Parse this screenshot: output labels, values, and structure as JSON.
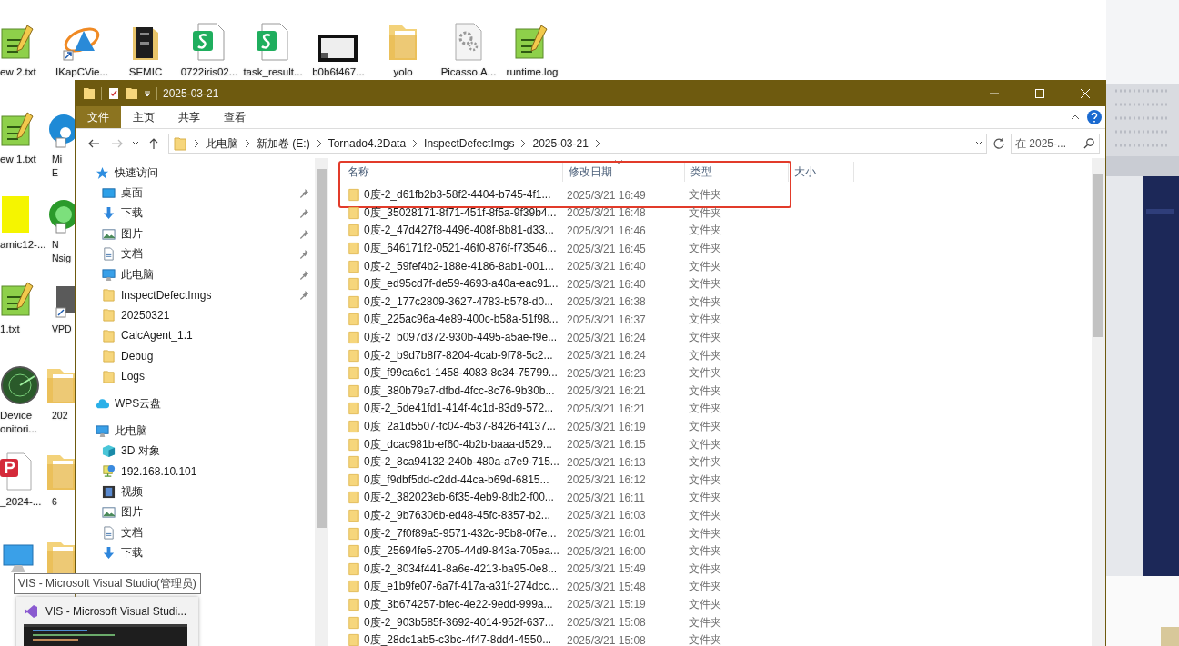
{
  "desktop": {
    "top_row": [
      {
        "kind": "notepad",
        "label": "ew 2.txt"
      },
      {
        "kind": "triangle-app",
        "label": "IKapCVie..."
      },
      {
        "kind": "dark-folder",
        "label": "SEMIC"
      },
      {
        "kind": "sheet",
        "label": "0722iris02..."
      },
      {
        "kind": "sheet",
        "label": "task_result..."
      },
      {
        "kind": "thumbnail",
        "label": "b0b6f467..."
      },
      {
        "kind": "folder",
        "label": "yolo"
      },
      {
        "kind": "gear-doc",
        "label": "Picasso.A..."
      },
      {
        "kind": "notepad",
        "label": "runtime.log"
      }
    ],
    "column_1": [
      {
        "kind": "notepad",
        "label": "ew 1.txt"
      },
      {
        "kind": "yellow-doc",
        "label": "amic12-..."
      },
      {
        "kind": "notepad",
        "label": "1.txt"
      },
      {
        "kind": "radar",
        "label": "Device\nonitori..."
      },
      {
        "kind": "pdf",
        "label": "_2024-..."
      },
      {
        "kind": "computer"
      }
    ],
    "column_2": [
      {
        "kind": "browser",
        "label": "Mi\nE"
      },
      {
        "kind": "green-orb",
        "label": "N\nNsig"
      },
      {
        "kind": "shortcut",
        "label": "VPD"
      },
      {
        "kind": "folder",
        "label": "202"
      },
      {
        "kind": "folder",
        "label": "6"
      },
      {
        "kind": "folder"
      }
    ]
  },
  "window": {
    "title": "2025-03-21",
    "tabs": [
      {
        "label": "文件",
        "selected": true
      },
      {
        "label": "主页",
        "selected": false
      },
      {
        "label": "共享",
        "selected": false
      },
      {
        "label": "查看",
        "selected": false
      }
    ],
    "address": {
      "crumbs": [
        "此电脑",
        "新加卷 (E:)",
        "Tornado4.2Data",
        "InspectDefectImgs",
        "2025-03-21"
      ]
    },
    "search": {
      "placeholder": "在 2025-..."
    },
    "nav": [
      {
        "kind": "star",
        "label": "快速访问",
        "children": [
          {
            "kind": "desktop",
            "label": "桌面",
            "pinned": true
          },
          {
            "kind": "download",
            "label": "下载",
            "pinned": true
          },
          {
            "kind": "pictures",
            "label": "图片",
            "pinned": true
          },
          {
            "kind": "documents",
            "label": "文档",
            "pinned": true
          },
          {
            "kind": "computer",
            "label": "此电脑",
            "pinned": true
          },
          {
            "kind": "folder",
            "label": "InspectDefectImgs",
            "pinned": true
          },
          {
            "kind": "folder",
            "label": "20250321",
            "pinned": false
          },
          {
            "kind": "folder",
            "label": "CalcAgent_1.1",
            "pinned": false
          },
          {
            "kind": "folder",
            "label": "Debug",
            "pinned": false
          },
          {
            "kind": "folder",
            "label": "Logs",
            "pinned": false
          }
        ]
      },
      {
        "kind": "cloud",
        "label": "WPS云盘"
      },
      {
        "kind": "computer",
        "label": "此电脑",
        "children": [
          {
            "kind": "cube",
            "label": "3D 对象",
            "pinned": false
          },
          {
            "kind": "network",
            "label": "192.168.10.101",
            "pinned": false
          },
          {
            "kind": "videos",
            "label": "视频",
            "pinned": false
          },
          {
            "kind": "pictures",
            "label": "图片",
            "pinned": false
          },
          {
            "kind": "documents",
            "label": "文档",
            "pinned": false
          },
          {
            "kind": "download",
            "label": "下载",
            "pinned": false
          }
        ]
      }
    ],
    "files": {
      "columns": [
        {
          "label": "名称",
          "sorted": false
        },
        {
          "label": "修改日期",
          "sorted": true
        },
        {
          "label": "类型",
          "sorted": false
        },
        {
          "label": "大小",
          "sorted": false
        }
      ],
      "rows": [
        {
          "name": "0度-2_d61fb2b3-58f2-4404-b745-4f1...",
          "date": "2025/3/21 16:49",
          "type": "文件夹",
          "highlighted": true
        },
        {
          "name": "0度_35028171-8f71-451f-8f5a-9f39b4...",
          "date": "2025/3/21 16:48",
          "type": "文件夹",
          "highlighted": false
        },
        {
          "name": "0度-2_47d427f8-4496-408f-8b81-d33...",
          "date": "2025/3/21 16:46",
          "type": "文件夹",
          "highlighted": false
        },
        {
          "name": "0度_646171f2-0521-46f0-876f-f73546...",
          "date": "2025/3/21 16:45",
          "type": "文件夹",
          "highlighted": false
        },
        {
          "name": "0度-2_59fef4b2-188e-4186-8ab1-001...",
          "date": "2025/3/21 16:40",
          "type": "文件夹",
          "highlighted": false
        },
        {
          "name": "0度_ed95cd7f-de59-4693-a40a-eac91...",
          "date": "2025/3/21 16:40",
          "type": "文件夹",
          "highlighted": false
        },
        {
          "name": "0度-2_177c2809-3627-4783-b578-d0...",
          "date": "2025/3/21 16:38",
          "type": "文件夹",
          "highlighted": false
        },
        {
          "name": "0度_225ac96a-4e89-400c-b58a-51f98...",
          "date": "2025/3/21 16:37",
          "type": "文件夹",
          "highlighted": false
        },
        {
          "name": "0度-2_b097d372-930b-4495-a5ae-f9e...",
          "date": "2025/3/21 16:24",
          "type": "文件夹",
          "highlighted": false
        },
        {
          "name": "0度-2_b9d7b8f7-8204-4cab-9f78-5c2...",
          "date": "2025/3/21 16:24",
          "type": "文件夹",
          "highlighted": false
        },
        {
          "name": "0度_f99ca6c1-1458-4083-8c34-75799...",
          "date": "2025/3/21 16:23",
          "type": "文件夹",
          "highlighted": false
        },
        {
          "name": "0度_380b79a7-dfbd-4fcc-8c76-9b30b...",
          "date": "2025/3/21 16:21",
          "type": "文件夹",
          "highlighted": false
        },
        {
          "name": "0度-2_5de41fd1-414f-4c1d-83d9-572...",
          "date": "2025/3/21 16:21",
          "type": "文件夹",
          "highlighted": false
        },
        {
          "name": "0度_2a1d5507-fc04-4537-8426-f4137...",
          "date": "2025/3/21 16:19",
          "type": "文件夹",
          "highlighted": false
        },
        {
          "name": "0度_dcac981b-ef60-4b2b-baaa-d529...",
          "date": "2025/3/21 16:15",
          "type": "文件夹",
          "highlighted": false
        },
        {
          "name": "0度-2_8ca94132-240b-480a-a7e9-715...",
          "date": "2025/3/21 16:13",
          "type": "文件夹",
          "highlighted": false
        },
        {
          "name": "0度_f9dbf5dd-c2dd-44ca-b69d-6815...",
          "date": "2025/3/21 16:12",
          "type": "文件夹",
          "highlighted": false
        },
        {
          "name": "0度-2_382023eb-6f35-4eb9-8db2-f00...",
          "date": "2025/3/21 16:11",
          "type": "文件夹",
          "highlighted": false
        },
        {
          "name": "0度-2_9b76306b-ed48-45fc-8357-b2...",
          "date": "2025/3/21 16:03",
          "type": "文件夹",
          "highlighted": false
        },
        {
          "name": "0度-2_7f0f89a5-9571-432c-95b8-0f7e...",
          "date": "2025/3/21 16:01",
          "type": "文件夹",
          "highlighted": false
        },
        {
          "name": "0度_25694fe5-2705-44d9-843a-705ea...",
          "date": "2025/3/21 16:00",
          "type": "文件夹",
          "highlighted": false
        },
        {
          "name": "0度-2_8034f441-8a6e-4213-ba95-0e8...",
          "date": "2025/3/21 15:49",
          "type": "文件夹",
          "highlighted": false
        },
        {
          "name": "0度_e1b9fe07-6a7f-417a-a31f-274dcc...",
          "date": "2025/3/21 15:48",
          "type": "文件夹",
          "highlighted": false
        },
        {
          "name": "0度_3b674257-bfec-4e22-9edd-999a...",
          "date": "2025/3/21 15:19",
          "type": "文件夹",
          "highlighted": false
        },
        {
          "name": "0度-2_903b585f-3692-4014-952f-637...",
          "date": "2025/3/21 15:08",
          "type": "文件夹",
          "highlighted": false
        },
        {
          "name": "0度_28dc1ab5-c3bc-4f47-8dd4-4550...",
          "date": "2025/3/21 15:08",
          "type": "文件夹",
          "highlighted": false
        }
      ]
    }
  },
  "taskbar_preview": {
    "tooltip": "VIS - Microsoft Visual Studio(管理员)",
    "title": "VIS - Microsoft Visual Studi..."
  }
}
